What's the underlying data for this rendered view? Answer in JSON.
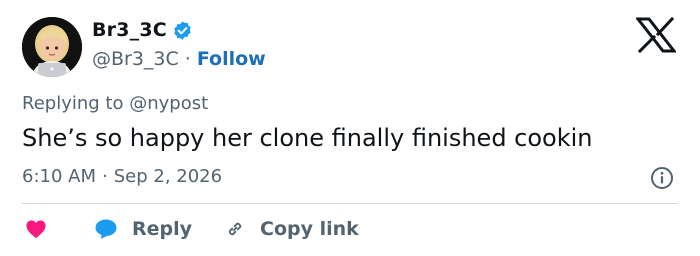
{
  "author": {
    "display_name": "Br3_3C",
    "handle": "@Br3_3C",
    "separator": "·",
    "follow_label": "Follow"
  },
  "reply": {
    "prefix": "Replying to",
    "mention": "@nypost"
  },
  "tweet": {
    "text": "She’s so happy her clone finally finished cookin",
    "time": "6:10 AM",
    "dot": "·",
    "date": "Sep 2, 2026"
  },
  "actions": {
    "reply_label": "Reply",
    "copy_link_label": "Copy link"
  },
  "icons": [
    "avatar",
    "verified-badge-icon",
    "x-logo-icon",
    "info-icon",
    "heart-icon",
    "reply-bubble-icon",
    "link-icon"
  ],
  "colors": {
    "text": "#0f1419",
    "secondary": "#536471",
    "follow": "#1d6fb8",
    "verified": "#1d9bf0",
    "heart": "#f91880",
    "reply_bubble": "#1d9bf0",
    "divider": "#cfd9de"
  }
}
